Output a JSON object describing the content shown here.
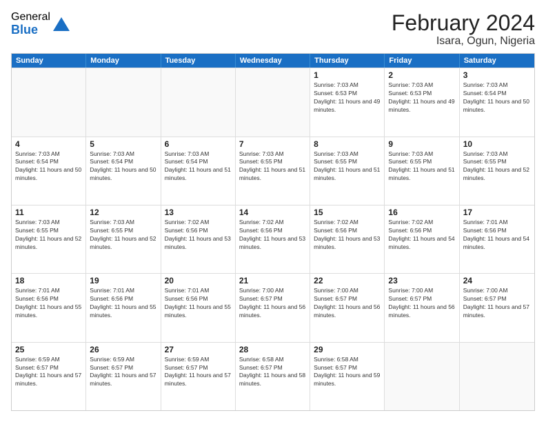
{
  "logo": {
    "general": "General",
    "blue": "Blue"
  },
  "title": "February 2024",
  "subtitle": "Isara, Ogun, Nigeria",
  "header_days": [
    "Sunday",
    "Monday",
    "Tuesday",
    "Wednesday",
    "Thursday",
    "Friday",
    "Saturday"
  ],
  "weeks": [
    [
      {
        "day": "",
        "info": "",
        "empty": true
      },
      {
        "day": "",
        "info": "",
        "empty": true
      },
      {
        "day": "",
        "info": "",
        "empty": true
      },
      {
        "day": "",
        "info": "",
        "empty": true
      },
      {
        "day": "1",
        "info": "Sunrise: 7:03 AM\nSunset: 6:53 PM\nDaylight: 11 hours and 49 minutes.",
        "empty": false
      },
      {
        "day": "2",
        "info": "Sunrise: 7:03 AM\nSunset: 6:53 PM\nDaylight: 11 hours and 49 minutes.",
        "empty": false
      },
      {
        "day": "3",
        "info": "Sunrise: 7:03 AM\nSunset: 6:54 PM\nDaylight: 11 hours and 50 minutes.",
        "empty": false
      }
    ],
    [
      {
        "day": "4",
        "info": "Sunrise: 7:03 AM\nSunset: 6:54 PM\nDaylight: 11 hours and 50 minutes.",
        "empty": false
      },
      {
        "day": "5",
        "info": "Sunrise: 7:03 AM\nSunset: 6:54 PM\nDaylight: 11 hours and 50 minutes.",
        "empty": false
      },
      {
        "day": "6",
        "info": "Sunrise: 7:03 AM\nSunset: 6:54 PM\nDaylight: 11 hours and 51 minutes.",
        "empty": false
      },
      {
        "day": "7",
        "info": "Sunrise: 7:03 AM\nSunset: 6:55 PM\nDaylight: 11 hours and 51 minutes.",
        "empty": false
      },
      {
        "day": "8",
        "info": "Sunrise: 7:03 AM\nSunset: 6:55 PM\nDaylight: 11 hours and 51 minutes.",
        "empty": false
      },
      {
        "day": "9",
        "info": "Sunrise: 7:03 AM\nSunset: 6:55 PM\nDaylight: 11 hours and 51 minutes.",
        "empty": false
      },
      {
        "day": "10",
        "info": "Sunrise: 7:03 AM\nSunset: 6:55 PM\nDaylight: 11 hours and 52 minutes.",
        "empty": false
      }
    ],
    [
      {
        "day": "11",
        "info": "Sunrise: 7:03 AM\nSunset: 6:55 PM\nDaylight: 11 hours and 52 minutes.",
        "empty": false
      },
      {
        "day": "12",
        "info": "Sunrise: 7:03 AM\nSunset: 6:55 PM\nDaylight: 11 hours and 52 minutes.",
        "empty": false
      },
      {
        "day": "13",
        "info": "Sunrise: 7:02 AM\nSunset: 6:56 PM\nDaylight: 11 hours and 53 minutes.",
        "empty": false
      },
      {
        "day": "14",
        "info": "Sunrise: 7:02 AM\nSunset: 6:56 PM\nDaylight: 11 hours and 53 minutes.",
        "empty": false
      },
      {
        "day": "15",
        "info": "Sunrise: 7:02 AM\nSunset: 6:56 PM\nDaylight: 11 hours and 53 minutes.",
        "empty": false
      },
      {
        "day": "16",
        "info": "Sunrise: 7:02 AM\nSunset: 6:56 PM\nDaylight: 11 hours and 54 minutes.",
        "empty": false
      },
      {
        "day": "17",
        "info": "Sunrise: 7:01 AM\nSunset: 6:56 PM\nDaylight: 11 hours and 54 minutes.",
        "empty": false
      }
    ],
    [
      {
        "day": "18",
        "info": "Sunrise: 7:01 AM\nSunset: 6:56 PM\nDaylight: 11 hours and 55 minutes.",
        "empty": false
      },
      {
        "day": "19",
        "info": "Sunrise: 7:01 AM\nSunset: 6:56 PM\nDaylight: 11 hours and 55 minutes.",
        "empty": false
      },
      {
        "day": "20",
        "info": "Sunrise: 7:01 AM\nSunset: 6:56 PM\nDaylight: 11 hours and 55 minutes.",
        "empty": false
      },
      {
        "day": "21",
        "info": "Sunrise: 7:00 AM\nSunset: 6:57 PM\nDaylight: 11 hours and 56 minutes.",
        "empty": false
      },
      {
        "day": "22",
        "info": "Sunrise: 7:00 AM\nSunset: 6:57 PM\nDaylight: 11 hours and 56 minutes.",
        "empty": false
      },
      {
        "day": "23",
        "info": "Sunrise: 7:00 AM\nSunset: 6:57 PM\nDaylight: 11 hours and 56 minutes.",
        "empty": false
      },
      {
        "day": "24",
        "info": "Sunrise: 7:00 AM\nSunset: 6:57 PM\nDaylight: 11 hours and 57 minutes.",
        "empty": false
      }
    ],
    [
      {
        "day": "25",
        "info": "Sunrise: 6:59 AM\nSunset: 6:57 PM\nDaylight: 11 hours and 57 minutes.",
        "empty": false
      },
      {
        "day": "26",
        "info": "Sunrise: 6:59 AM\nSunset: 6:57 PM\nDaylight: 11 hours and 57 minutes.",
        "empty": false
      },
      {
        "day": "27",
        "info": "Sunrise: 6:59 AM\nSunset: 6:57 PM\nDaylight: 11 hours and 57 minutes.",
        "empty": false
      },
      {
        "day": "28",
        "info": "Sunrise: 6:58 AM\nSunset: 6:57 PM\nDaylight: 11 hours and 58 minutes.",
        "empty": false
      },
      {
        "day": "29",
        "info": "Sunrise: 6:58 AM\nSunset: 6:57 PM\nDaylight: 11 hours and 59 minutes.",
        "empty": false
      },
      {
        "day": "",
        "info": "",
        "empty": true
      },
      {
        "day": "",
        "info": "",
        "empty": true
      }
    ]
  ]
}
